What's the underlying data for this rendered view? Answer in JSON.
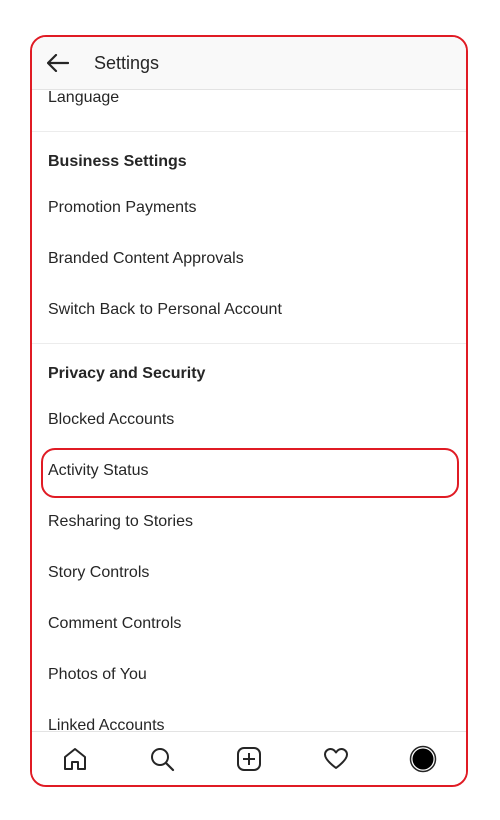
{
  "header": {
    "title": "Settings"
  },
  "items": {
    "language": "Language",
    "business_header": "Business Settings",
    "promotion_payments": "Promotion Payments",
    "branded_content": "Branded Content Approvals",
    "switch_personal": "Switch Back to Personal Account",
    "privacy_header": "Privacy and Security",
    "blocked_accounts": "Blocked Accounts",
    "activity_status": "Activity Status",
    "resharing": "Resharing to Stories",
    "story_controls": "Story Controls",
    "comment_controls": "Comment Controls",
    "photos_of_you": "Photos of You",
    "linked_accounts": "Linked Accounts"
  },
  "tabbar": {
    "icons": [
      "home-icon",
      "search-icon",
      "new-post-icon",
      "activity-heart-icon",
      "profile-icon"
    ]
  },
  "colors": {
    "highlight": "#e01b24",
    "text": "#262626"
  }
}
